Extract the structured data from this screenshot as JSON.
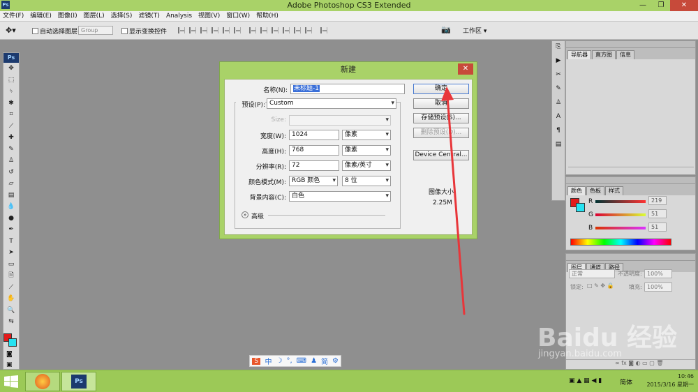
{
  "window": {
    "title": "Adobe Photoshop CS3 Extended",
    "logo": "Ps"
  },
  "menu": [
    "文件(F)",
    "编辑(E)",
    "图像(I)",
    "图层(L)",
    "选择(S)",
    "滤镜(T)",
    "Analysis",
    "视图(V)",
    "窗口(W)",
    "帮助(H)"
  ],
  "options": {
    "auto_select": "自动选择图层",
    "group_value": "Group",
    "show_transform": "显示变换控件",
    "workspace": "工作区"
  },
  "panels": {
    "nav_tabs": [
      "导航器",
      "直方图",
      "信息"
    ],
    "color_tabs": [
      "颜色",
      "色板",
      "样式"
    ],
    "color_values": {
      "r_label": "R",
      "r": "219",
      "g_label": "G",
      "g": "51",
      "b_label": "B",
      "b": "51"
    },
    "layers_tabs": [
      "图层",
      "通道",
      "路径"
    ],
    "blend_mode": "正常",
    "opacity_label": "不透明度:",
    "opacity": "100%",
    "lock_label": "锁定:",
    "fill_label": "填充:",
    "fill": "100%"
  },
  "dialog": {
    "title": "新建",
    "name_label": "名称(N):",
    "name_value": "未标题-1",
    "preset_label": "预设(P):",
    "preset_value": "Custom",
    "size_label": "Size:",
    "width_label": "宽度(W):",
    "width_value": "1024",
    "width_unit": "像素",
    "height_label": "高度(H):",
    "height_value": "768",
    "height_unit": "像素",
    "resolution_label": "分辨率(R):",
    "resolution_value": "72",
    "resolution_unit": "像素/英寸",
    "mode_label": "颜色模式(M):",
    "mode_value": "RGB 颜色",
    "bits_value": "8 位",
    "bg_label": "背景内容(C):",
    "bg_value": "白色",
    "advanced_label": "高级",
    "ok": "确定",
    "cancel": "取消",
    "save_preset": "存储预设(S)...",
    "delete_preset": "删除预设(D)...",
    "device_central": "Device Central...",
    "image_size_label": "图像大小:",
    "image_size_value": "2.25M",
    "close": "✕"
  },
  "ime": {
    "main": "中",
    "simplified": "简"
  },
  "taskbar": {
    "time": "10:46",
    "date": "2015/3/16 星期一",
    "lang": "简体"
  },
  "watermark": {
    "logo": "Baidu 经验",
    "url": "jingyan.baidu.com"
  },
  "colors": {
    "titlebar": "#a9d268",
    "foreground": "#e21b1b",
    "background": "#26e3f2",
    "arrow": "#e8363a"
  }
}
